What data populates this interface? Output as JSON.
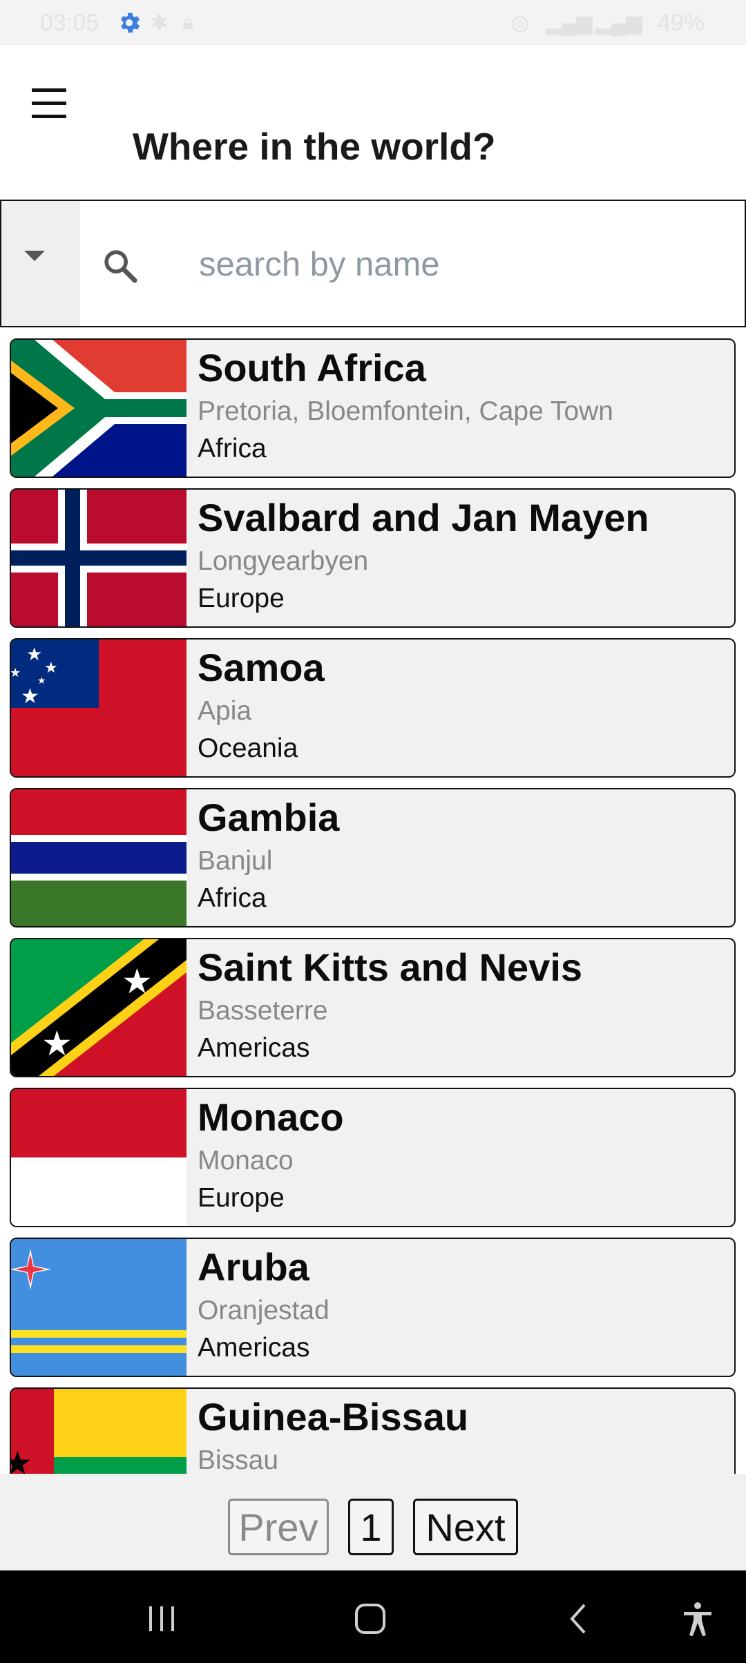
{
  "status_bar": {
    "time": "03:05",
    "battery": "49%",
    "accent": "#3b7de0"
  },
  "app": {
    "title": "Where in the world?"
  },
  "search": {
    "placeholder": "search by name"
  },
  "countries": [
    {
      "name": "South Africa",
      "capital": "Pretoria, Bloemfontein, Cape Town",
      "region": "Africa",
      "flag_icon": "south-africa-flag-icon"
    },
    {
      "name": "Svalbard and Jan Mayen",
      "capital": "Longyearbyen",
      "region": "Europe",
      "flag_icon": "svalbard-flag-icon"
    },
    {
      "name": "Samoa",
      "capital": "Apia",
      "region": "Oceania",
      "flag_icon": "samoa-flag-icon"
    },
    {
      "name": "Gambia",
      "capital": "Banjul",
      "region": "Africa",
      "flag_icon": "gambia-flag-icon"
    },
    {
      "name": "Saint Kitts and Nevis",
      "capital": "Basseterre",
      "region": "Americas",
      "flag_icon": "saint-kitts-flag-icon"
    },
    {
      "name": "Monaco",
      "capital": "Monaco",
      "region": "Europe",
      "flag_icon": "monaco-flag-icon"
    },
    {
      "name": "Aruba",
      "capital": "Oranjestad",
      "region": "Americas",
      "flag_icon": "aruba-flag-icon"
    },
    {
      "name": "Guinea-Bissau",
      "capital": "Bissau",
      "region": "",
      "flag_icon": "guinea-bissau-flag-icon"
    }
  ],
  "pagination": {
    "prev_label": "Prev",
    "page_label": "1",
    "next_label": "Next"
  },
  "nav_bar": {
    "icons": [
      "recent-apps-icon",
      "home-icon",
      "back-icon",
      "accessibility-icon"
    ]
  }
}
